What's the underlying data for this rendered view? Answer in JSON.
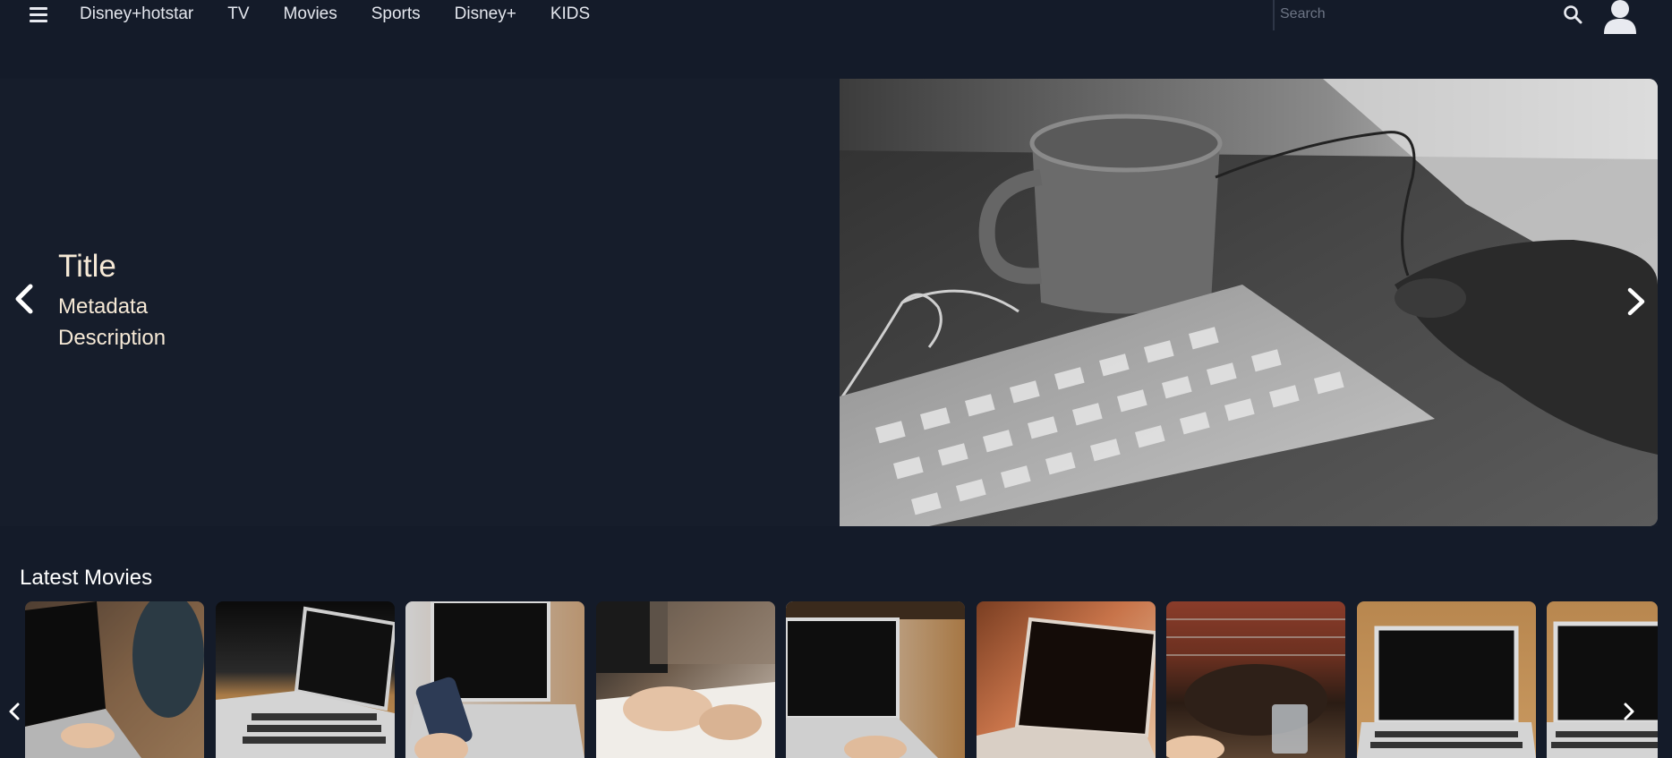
{
  "nav": {
    "menu_icon": "hamburger-icon",
    "items": [
      {
        "label": "Disney+hotstar"
      },
      {
        "label": "TV"
      },
      {
        "label": "Movies"
      },
      {
        "label": "Sports"
      },
      {
        "label": "Disney+"
      },
      {
        "label": "KIDS"
      }
    ],
    "search": {
      "placeholder": "Search",
      "value": "",
      "icon": "search-icon"
    },
    "avatar_icon": "user-icon"
  },
  "hero": {
    "title": "Title",
    "metadata": "Metadata",
    "description": "Description",
    "prev_icon": "chevron-left-icon",
    "next_icon": "chevron-right-icon",
    "image": "keyboard-mouse-mug-photo"
  },
  "latest": {
    "heading": "Latest Movies",
    "prev_icon": "chevron-left-icon",
    "next_icon": "chevron-right-icon",
    "tiles": [
      {
        "image": "laptop-typing-photo"
      },
      {
        "image": "laptop-on-table-photo"
      },
      {
        "image": "phone-and-laptop-photo"
      },
      {
        "image": "writing-notes-photo"
      },
      {
        "image": "laptop-typing-photo-2"
      },
      {
        "image": "laptop-orange-light-photo"
      },
      {
        "image": "bag-and-glass-photo"
      },
      {
        "image": "laptop-wood-table-photo"
      },
      {
        "image": "laptop-wood-table-photo-2"
      }
    ]
  },
  "colors": {
    "background": "#141b29",
    "hero_background": "#161d2b",
    "hero_text": "#f6e9d6",
    "nav_text": "#e4e7ee"
  }
}
